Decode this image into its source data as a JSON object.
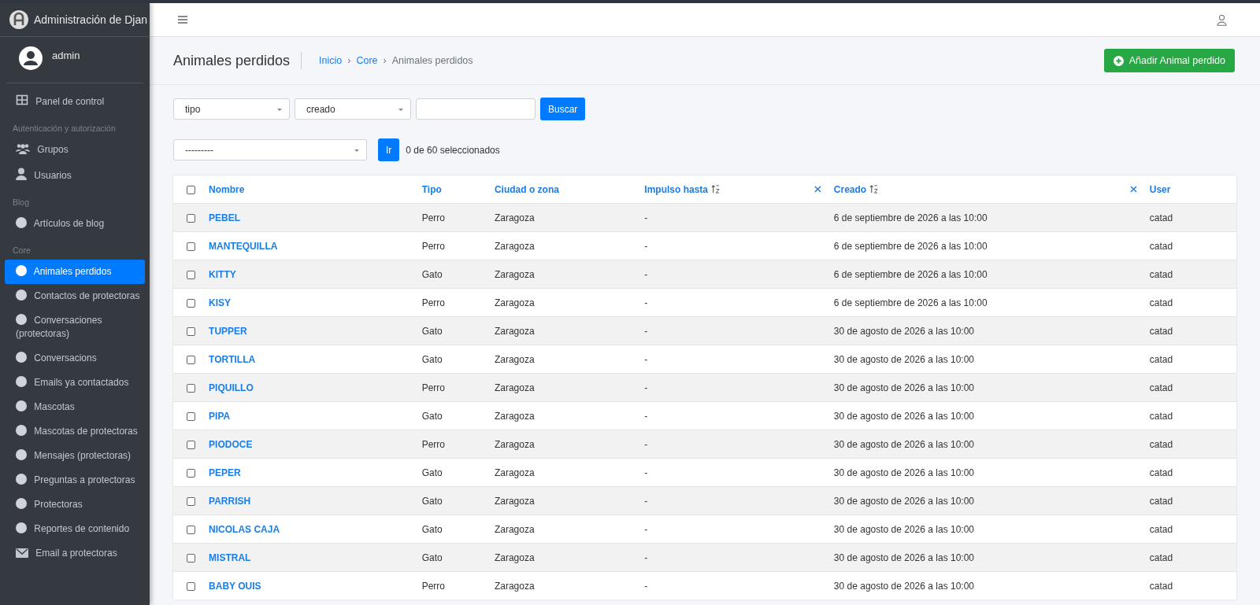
{
  "sidebar": {
    "brand": "Administración de Djan",
    "user": "admin",
    "sections": [
      {
        "items": [
          {
            "label": "Panel de control",
            "kind": "dashboard",
            "selected": false
          }
        ]
      },
      {
        "heading": "Autenticación y autorización",
        "items": [
          {
            "label": "Grupos",
            "kind": "group",
            "selected": false
          },
          {
            "label": "Usuarios",
            "kind": "user",
            "selected": false
          }
        ]
      },
      {
        "heading": "Blog",
        "items": [
          {
            "label": "Artículos de blog",
            "kind": "dot",
            "selected": false
          }
        ]
      },
      {
        "heading": "Core",
        "items": [
          {
            "label": "Animales perdidos",
            "kind": "dot",
            "selected": true
          },
          {
            "label": "Contactos de protectoras",
            "kind": "dot",
            "selected": false
          },
          {
            "label": "Conversaciones (protectoras)",
            "kind": "dot",
            "selected": false
          },
          {
            "label": "Conversacions",
            "kind": "dot",
            "selected": false
          },
          {
            "label": "Emails ya contactados",
            "kind": "dot",
            "selected": false
          },
          {
            "label": "Mascotas",
            "kind": "dot",
            "selected": false
          },
          {
            "label": "Mascotas de protectoras",
            "kind": "dot",
            "selected": false
          },
          {
            "label": "Mensajes (protectoras)",
            "kind": "dot",
            "selected": false
          },
          {
            "label": "Preguntas a protectoras",
            "kind": "dot",
            "selected": false
          },
          {
            "label": "Protectoras",
            "kind": "dot",
            "selected": false
          },
          {
            "label": "Reportes de contenido",
            "kind": "dot",
            "selected": false
          },
          {
            "label": "Email a protectoras",
            "kind": "mail",
            "selected": false
          }
        ]
      }
    ]
  },
  "page": {
    "title": "Animales perdidos",
    "breadcrumb": [
      {
        "label": "Inicio",
        "current": false
      },
      {
        "separator": "›",
        "label": "Core",
        "current": false
      },
      {
        "separator": "›",
        "label": "Animales perdidos",
        "current": true
      }
    ],
    "add_button": "Añadir Animal perdido"
  },
  "filters": {
    "dropdowns": [
      "tipo",
      "creado"
    ],
    "search_button": "Buscar"
  },
  "actions": {
    "dropdown": "---------",
    "go_button": "Ir",
    "counter": "0 de 60 seleccionados"
  },
  "table": {
    "select_all": {
      "checked": false
    },
    "columns": [
      {
        "label": "Nombre",
        "sorted": false
      },
      {
        "label": "Tipo",
        "sorted": false
      },
      {
        "label": "Ciudad o zona",
        "sorted": false
      },
      {
        "label": "Impulso hasta",
        "sorted": true
      },
      {
        "label": "Creado",
        "sorted": true
      },
      {
        "label": "User",
        "sorted": false
      }
    ],
    "rows": [
      {
        "checked": false,
        "cells": [
          "PEBEL",
          "Perro",
          "Zaragoza",
          "-",
          "6 de septiembre de 2026 a las 10:00",
          "catad"
        ]
      },
      {
        "checked": false,
        "cells": [
          "MANTEQUILLA",
          "Perro",
          "Zaragoza",
          "-",
          "6 de septiembre de 2026 a las 10:00",
          "catad"
        ]
      },
      {
        "checked": false,
        "cells": [
          "KITTY",
          "Gato",
          "Zaragoza",
          "-",
          "6 de septiembre de 2026 a las 10:00",
          "catad"
        ]
      },
      {
        "checked": false,
        "cells": [
          "KISY",
          "Perro",
          "Zaragoza",
          "-",
          "6 de septiembre de 2026 a las 10:00",
          "catad"
        ]
      },
      {
        "checked": false,
        "cells": [
          "TUPPER",
          "Gato",
          "Zaragoza",
          "-",
          "30 de agosto de 2026 a las 10:00",
          "catad"
        ]
      },
      {
        "checked": false,
        "cells": [
          "TORTILLA",
          "Gato",
          "Zaragoza",
          "-",
          "30 de agosto de 2026 a las 10:00",
          "catad"
        ]
      },
      {
        "checked": false,
        "cells": [
          "PIQUILLO",
          "Perro",
          "Zaragoza",
          "-",
          "30 de agosto de 2026 a las 10:00",
          "catad"
        ]
      },
      {
        "checked": false,
        "cells": [
          "PIPA",
          "Gato",
          "Zaragoza",
          "-",
          "30 de agosto de 2026 a las 10:00",
          "catad"
        ]
      },
      {
        "checked": false,
        "cells": [
          "PIODOCE",
          "Perro",
          "Zaragoza",
          "-",
          "30 de agosto de 2026 a las 10:00",
          "catad"
        ]
      },
      {
        "checked": false,
        "cells": [
          "PEPER",
          "Gato",
          "Zaragoza",
          "-",
          "30 de agosto de 2026 a las 10:00",
          "catad"
        ]
      },
      {
        "checked": false,
        "cells": [
          "PARRISH",
          "Gato",
          "Zaragoza",
          "-",
          "30 de agosto de 2026 a las 10:00",
          "catad"
        ]
      },
      {
        "checked": false,
        "cells": [
          "NICOLAS CAJA",
          "Gato",
          "Zaragoza",
          "-",
          "30 de agosto de 2026 a las 10:00",
          "catad"
        ]
      },
      {
        "checked": false,
        "cells": [
          "MISTRAL",
          "Gato",
          "Zaragoza",
          "-",
          "30 de agosto de 2026 a las 10:00",
          "catad"
        ]
      },
      {
        "checked": false,
        "cells": [
          "BABY OUIS",
          "Perro",
          "Zaragoza",
          "-",
          "30 de agosto de 2026 a las 10:00",
          "catad"
        ]
      }
    ]
  }
}
